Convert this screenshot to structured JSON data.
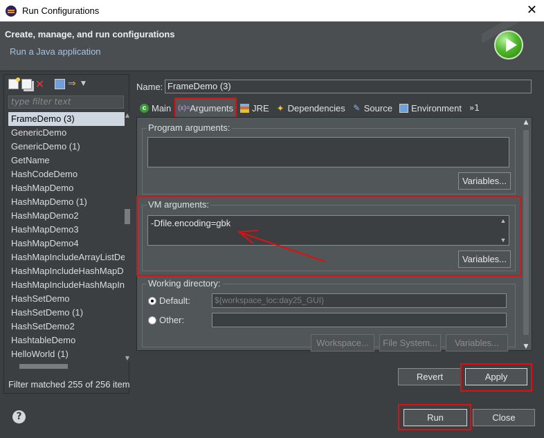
{
  "window": {
    "title": "Run Configurations",
    "close_glyph": "✕"
  },
  "header": {
    "title": "Create, manage, and run configurations",
    "subtitle": "Run a Java application",
    "banner_icon": "run-banner-icon"
  },
  "left": {
    "toolbar_icons": [
      "new-config-icon",
      "duplicate-icon",
      "delete-icon",
      "collapse-all-icon",
      "filter-icon",
      "dropdown-caret-icon"
    ],
    "filter_placeholder": "type filter text",
    "items": [
      "FrameDemo (3)",
      "GenericDemo",
      "GenericDemo (1)",
      "GetName",
      "HashCodeDemo",
      "HashMapDemo",
      "HashMapDemo (1)",
      "HashMapDemo2",
      "HashMapDemo3",
      "HashMapDemo4",
      "HashMapIncludeArrayListDe",
      "HashMapIncludeHashMapD",
      "HashMapIncludeHashMapIn",
      "HashSetDemo",
      "HashSetDemo (1)",
      "HashSetDemo2",
      "HashtableDemo",
      "HelloWorld (1)"
    ],
    "selected_index": 0,
    "status": "Filter matched 255 of 256 item"
  },
  "config": {
    "name_label": "Name:",
    "name_value": "FrameDemo (3)",
    "tabs": [
      {
        "label": "Main",
        "icon": "c"
      },
      {
        "label": "Arguments",
        "icon": "(x)="
      },
      {
        "label": "JRE",
        "icon": ""
      },
      {
        "label": "Dependencies",
        "icon": "✦"
      },
      {
        "label": "Source",
        "icon": "✎"
      },
      {
        "label": "Environment",
        "icon": ""
      }
    ],
    "tabs_more": "»1",
    "program_args": {
      "title": "Program arguments:",
      "value": "",
      "variables_button": "Variables..."
    },
    "vm_args": {
      "title": "VM arguments:",
      "value": "-Dfile.encoding=gbk",
      "variables_button": "Variables..."
    },
    "working_dir": {
      "title": "Working directory:",
      "default_label": "Default:",
      "default_value": "${workspace_loc:day25_GUI}",
      "other_label": "Other:",
      "other_value": "",
      "workspace_button": "Workspace...",
      "filesystem_button": "File System...",
      "variables_button": "Variables..."
    },
    "revert_button": "Revert",
    "apply_button": "Apply"
  },
  "footer": {
    "help_glyph": "?",
    "run_button": "Run",
    "close_button": "Close"
  },
  "colors": {
    "background": "#3c3f41",
    "highlight": "#e01010",
    "selected": "#ced6e0"
  }
}
